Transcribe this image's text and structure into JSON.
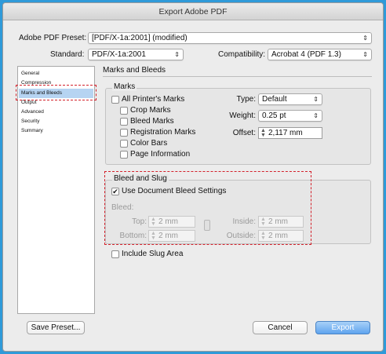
{
  "window": {
    "title": "Export Adobe PDF"
  },
  "preset": {
    "label": "Adobe PDF Preset:",
    "value": "[PDF/X-1a:2001] (modified)"
  },
  "standard": {
    "label": "Standard:",
    "value": "PDF/X-1a:2001"
  },
  "compatibility": {
    "label": "Compatibility:",
    "value": "Acrobat 4 (PDF 1.3)"
  },
  "sidebar": {
    "items": [
      {
        "label": "General"
      },
      {
        "label": "Compression"
      },
      {
        "label": "Marks and Bleeds"
      },
      {
        "label": "Output"
      },
      {
        "label": "Advanced"
      },
      {
        "label": "Security"
      },
      {
        "label": "Summary"
      }
    ],
    "selected_index": 2
  },
  "main": {
    "title": "Marks and Bleeds"
  },
  "marks": {
    "title": "Marks",
    "all_printers_marks": "All Printer's Marks",
    "crop_marks": "Crop Marks",
    "bleed_marks": "Bleed Marks",
    "registration_marks": "Registration Marks",
    "color_bars": "Color Bars",
    "page_information": "Page Information",
    "type_label": "Type:",
    "type_value": "Default",
    "weight_label": "Weight:",
    "weight_value": "0.25 pt",
    "offset_label": "Offset:",
    "offset_value": "2,117 mm"
  },
  "bleed": {
    "title": "Bleed and Slug",
    "use_document": "Use Document Bleed Settings",
    "use_document_checked": true,
    "bleed_label": "Bleed:",
    "top_label": "Top:",
    "top_value": "2 mm",
    "bottom_label": "Bottom:",
    "bottom_value": "2 mm",
    "inside_label": "Inside:",
    "inside_value": "2 mm",
    "outside_label": "Outside:",
    "outside_value": "2 mm",
    "include_slug": "Include Slug Area"
  },
  "buttons": {
    "save_preset": "Save Preset...",
    "cancel": "Cancel",
    "export": "Export"
  },
  "colors": {
    "accent": "#2f9ad9",
    "highlight_box": "#d3202a",
    "selection": "#b6d4f2"
  }
}
